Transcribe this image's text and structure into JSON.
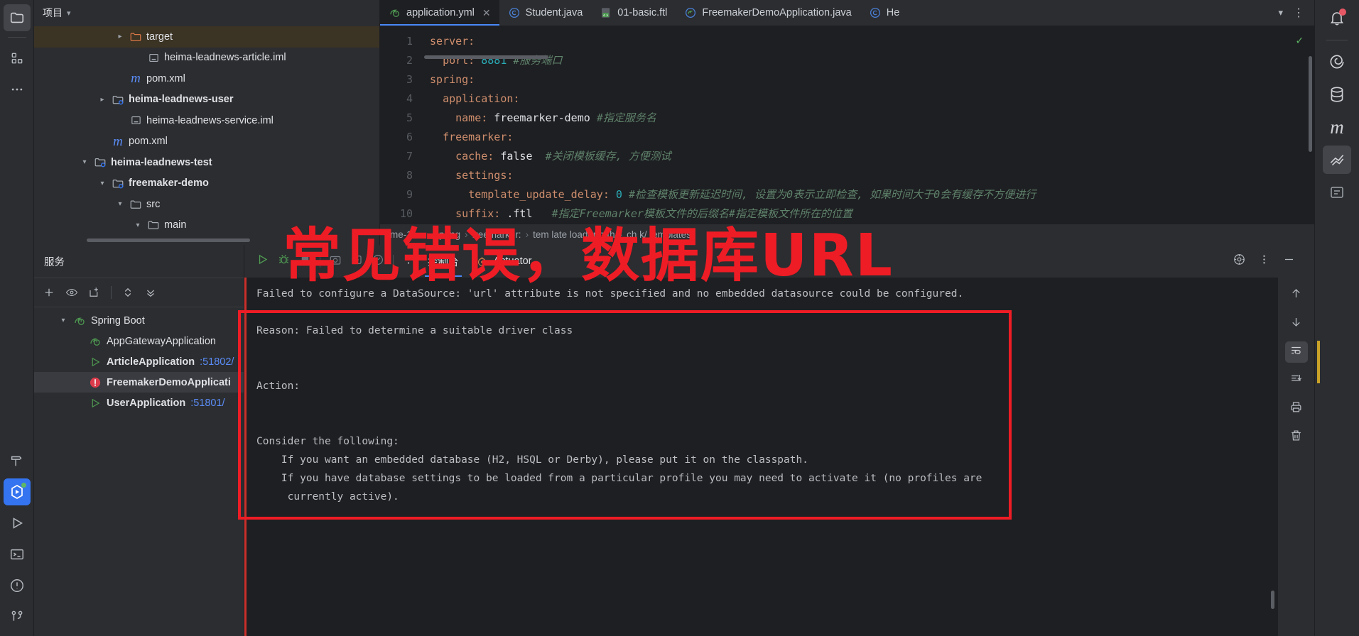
{
  "left_rail": {
    "items": [
      {
        "name": "project-view",
        "icon": "folder-icon",
        "active": true
      },
      {
        "name": "structure-view",
        "icon": "structure-icon",
        "active": false
      },
      {
        "name": "more-tool-windows",
        "icon": "ellipsis-icon",
        "active": false
      }
    ],
    "bottom_items": [
      {
        "name": "build-tool-window",
        "icon": "hammer-icon",
        "active": false
      },
      {
        "name": "services-tool-window",
        "icon": "services-icon",
        "active": true
      },
      {
        "name": "run-tool-window",
        "icon": "play-icon",
        "active": false
      },
      {
        "name": "terminal-tool-window",
        "icon": "terminal-icon",
        "active": false
      },
      {
        "name": "problems-tool-window",
        "icon": "warning-circle-icon",
        "active": false
      },
      {
        "name": "version-control-tool-window",
        "icon": "branch-icon",
        "active": false
      }
    ]
  },
  "project_panel": {
    "title": "项目",
    "tree": [
      {
        "indent": 4,
        "twisty": "right",
        "icon": "folder-orange-icon",
        "label": "target",
        "bold": false,
        "selected": true
      },
      {
        "indent": 5,
        "twisty": "none",
        "icon": "iml-icon",
        "label": "heima-leadnews-article.iml",
        "bold": false,
        "selected": false
      },
      {
        "indent": 4,
        "twisty": "none",
        "icon": "maven-icon",
        "label": "pom.xml",
        "bold": false,
        "selected": false
      },
      {
        "indent": 3,
        "twisty": "right",
        "icon": "module-icon",
        "label": "heima-leadnews-user",
        "bold": true,
        "selected": false
      },
      {
        "indent": 4,
        "twisty": "none",
        "icon": "iml-icon",
        "label": "heima-leadnews-service.iml",
        "bold": false,
        "selected": false
      },
      {
        "indent": 3,
        "twisty": "none",
        "icon": "maven-icon",
        "label": "pom.xml",
        "bold": false,
        "selected": false
      },
      {
        "indent": 2,
        "twisty": "down",
        "icon": "module-icon",
        "label": "heima-leadnews-test",
        "bold": true,
        "selected": false
      },
      {
        "indent": 3,
        "twisty": "down",
        "icon": "module-icon",
        "label": "freemaker-demo",
        "bold": true,
        "selected": false
      },
      {
        "indent": 4,
        "twisty": "down",
        "icon": "folder-icon",
        "label": "src",
        "bold": false,
        "selected": false
      },
      {
        "indent": 5,
        "twisty": "down",
        "icon": "folder-icon",
        "label": "main",
        "bold": false,
        "selected": false
      }
    ]
  },
  "editor": {
    "tabs": [
      {
        "label": "application.yml",
        "icon": "yaml-spring-icon",
        "active": true,
        "closable": true
      },
      {
        "label": "Student.java",
        "icon": "java-class-icon",
        "active": false,
        "closable": false
      },
      {
        "label": "01-basic.ftl",
        "icon": "ftl-file-icon",
        "active": false,
        "closable": false
      },
      {
        "label": "FreemakerDemoApplication.java",
        "icon": "spring-class-icon",
        "active": false,
        "closable": false
      },
      {
        "label": "He",
        "icon": "java-class-icon",
        "active": false,
        "closable": false
      }
    ],
    "tab_overflow_icon": "chevron-down-icon",
    "tab_options_icon": "more-vertical-icon",
    "inspection_status_icon": "checkmark-icon",
    "lines": [
      {
        "n": "1",
        "segments": [
          {
            "t": "server:",
            "c": "k"
          }
        ]
      },
      {
        "n": "2",
        "segments": [
          {
            "t": "  ",
            "c": "str"
          },
          {
            "t": "port:",
            "c": "k"
          },
          {
            "t": " ",
            "c": "str"
          },
          {
            "t": "8881",
            "c": "num"
          },
          {
            "t": " ",
            "c": "str"
          },
          {
            "t": "#服务端口",
            "c": "cm"
          }
        ]
      },
      {
        "n": "3",
        "segments": [
          {
            "t": "spring:",
            "c": "k"
          }
        ]
      },
      {
        "n": "4",
        "segments": [
          {
            "t": "  ",
            "c": "str"
          },
          {
            "t": "application:",
            "c": "k"
          }
        ]
      },
      {
        "n": "5",
        "segments": [
          {
            "t": "    ",
            "c": "str"
          },
          {
            "t": "name:",
            "c": "k"
          },
          {
            "t": " freemarker-demo ",
            "c": "str"
          },
          {
            "t": "#指定服务名",
            "c": "cm"
          }
        ]
      },
      {
        "n": "6",
        "segments": [
          {
            "t": "  ",
            "c": "str"
          },
          {
            "t": "freemarker:",
            "c": "k"
          }
        ]
      },
      {
        "n": "7",
        "segments": [
          {
            "t": "    ",
            "c": "str"
          },
          {
            "t": "cache:",
            "c": "k"
          },
          {
            "t": " false  ",
            "c": "str"
          },
          {
            "t": "#关闭模板缓存, 方便测试",
            "c": "cm"
          }
        ]
      },
      {
        "n": "8",
        "segments": [
          {
            "t": "    ",
            "c": "str"
          },
          {
            "t": "settings:",
            "c": "k"
          }
        ]
      },
      {
        "n": "9",
        "segments": [
          {
            "t": "      ",
            "c": "str"
          },
          {
            "t": "template_update_delay:",
            "c": "k"
          },
          {
            "t": " ",
            "c": "str"
          },
          {
            "t": "0",
            "c": "num"
          },
          {
            "t": " ",
            "c": "str"
          },
          {
            "t": "#检查模板更新延迟时间, 设置为0表示立即检查, 如果时间大于0会有缓存不方便进行",
            "c": "cm"
          }
        ]
      },
      {
        "n": "10",
        "segments": [
          {
            "t": "    ",
            "c": "str"
          },
          {
            "t": "suffix:",
            "c": "k"
          },
          {
            "t": " .ftl   ",
            "c": "str"
          },
          {
            "t": "#指定Freemarker模板文件的后缀名#指定模板文件所在的位置",
            "c": "cm"
          }
        ]
      }
    ],
    "breadcrumb": [
      "me-1/...",
      "spring",
      "freemarker:",
      "tem late loader p th",
      "ch k/ templates"
    ]
  },
  "services": {
    "title": "服务",
    "toolbar_icons": [
      "add-service-icon",
      "show-icon",
      "add-tab-icon",
      "expand-collapse-icon",
      "close-all-icon"
    ],
    "tree": [
      {
        "indent": 1,
        "twisty": "down",
        "icon": "spring-boot-icon",
        "label": "Spring Boot",
        "port": "",
        "bold": false,
        "selected": false,
        "status": "none"
      },
      {
        "indent": 2,
        "twisty": "none",
        "icon": "spring-boot-icon",
        "label": "AppGatewayApplication",
        "port": "",
        "bold": false,
        "selected": false,
        "status": "none"
      },
      {
        "indent": 2,
        "twisty": "none",
        "icon": "run-icon",
        "label": "ArticleApplication",
        "port": ":51802/",
        "bold": true,
        "selected": false,
        "status": "running"
      },
      {
        "indent": 2,
        "twisty": "none",
        "icon": "error-icon",
        "label": "FreemakerDemoApplicati",
        "port": "",
        "bold": true,
        "selected": true,
        "status": "error"
      },
      {
        "indent": 2,
        "twisty": "none",
        "icon": "run-icon",
        "label": "UserApplication",
        "port": ":51801/",
        "bold": true,
        "selected": false,
        "status": "running"
      }
    ]
  },
  "run_toolbar": {
    "buttons": [
      {
        "name": "rerun-button",
        "icon": "play-green-icon"
      },
      {
        "name": "debug-button",
        "icon": "bug-green-icon"
      },
      {
        "name": "stop-button",
        "icon": "stop-icon"
      },
      {
        "name": "screenshot-button",
        "icon": "camera-icon"
      },
      {
        "name": "thread-dump-button",
        "icon": "dump-icon"
      },
      {
        "name": "profiler-button",
        "icon": "gauge-icon"
      },
      {
        "name": "more-button",
        "icon": "more-vertical-icon"
      }
    ],
    "tabs": [
      {
        "label": "控制台",
        "icon": "",
        "active": true
      },
      {
        "label": "Actuator",
        "icon": "actuator-icon",
        "active": false
      }
    ]
  },
  "console": {
    "lines": [
      "Failed to configure a DataSource: 'url' attribute is not specified and no embedded datasource could be configured.",
      "",
      "Reason: Failed to determine a suitable driver class",
      "",
      "",
      "Action:",
      "",
      "",
      "Consider the following:",
      "    If you want an embedded database (H2, HSQL or Derby), please put it on the classpath.",
      "    If you have database settings to be loaded from a particular profile you may need to activate it (no profiles are",
      "     currently active)."
    ],
    "side_tools": [
      {
        "name": "scroll-up-button",
        "icon": "arrow-up-icon",
        "active": false
      },
      {
        "name": "scroll-down-button",
        "icon": "arrow-down-icon",
        "active": false
      },
      {
        "name": "soft-wrap-button",
        "icon": "soft-wrap-icon",
        "active": true
      },
      {
        "name": "scroll-to-end-button",
        "icon": "scroll-end-icon",
        "active": false
      },
      {
        "name": "print-button",
        "icon": "printer-icon",
        "active": false
      },
      {
        "name": "clear-all-button",
        "icon": "trash-icon",
        "active": false
      }
    ]
  },
  "annotation": {
    "title": "常见错误，数据库URL",
    "color": "#ee1c25"
  },
  "right_rail": {
    "items": [
      {
        "name": "notifications",
        "icon": "bell-icon",
        "active": false,
        "badge": true
      },
      {
        "name": "spring-tool",
        "icon": "spiral-icon",
        "active": false,
        "badge": false
      },
      {
        "name": "database-tool",
        "icon": "database-icon",
        "active": false,
        "badge": false
      },
      {
        "name": "maven-tool",
        "icon": "maven-m-icon",
        "active": false,
        "badge": false
      },
      {
        "name": "gradle-tool",
        "icon": "gradle-icon",
        "active": true,
        "badge": false
      },
      {
        "name": "ai-assistant",
        "icon": "assistant-icon",
        "active": false,
        "badge": false
      }
    ]
  },
  "window_controls": {
    "settings_icon": "gear-icon",
    "more_icon": "more-vertical-icon",
    "minimize_icon": "minimize-icon"
  }
}
